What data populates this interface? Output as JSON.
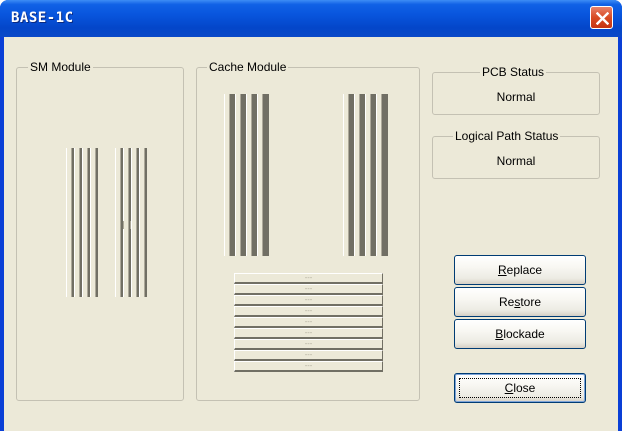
{
  "window": {
    "title": "BASE-1C"
  },
  "groups": {
    "sm_module": "SM Module",
    "cache_module": "Cache Module",
    "pcb_status": {
      "label": "PCB Status",
      "value": "Normal"
    },
    "logical_path_status": {
      "label": "Logical Path Status",
      "value": "Normal"
    }
  },
  "cache_slots": [
    "---",
    "---",
    "---",
    "---",
    "---",
    "---",
    "---",
    "---",
    "---"
  ],
  "buttons": {
    "replace": {
      "mnemonic": "R",
      "rest": "eplace"
    },
    "restore": {
      "pre": "Re",
      "mnemonic": "s",
      "rest": "tore"
    },
    "blockade": {
      "mnemonic": "B",
      "rest": "lockade"
    },
    "close": {
      "mnemonic": "C",
      "rest": "lose"
    }
  },
  "icons": {
    "title_close": "close-x-icon"
  },
  "colors": {
    "titlebar": "#0855dd",
    "face": "#ece9d8",
    "close_red": "#d84b23"
  }
}
